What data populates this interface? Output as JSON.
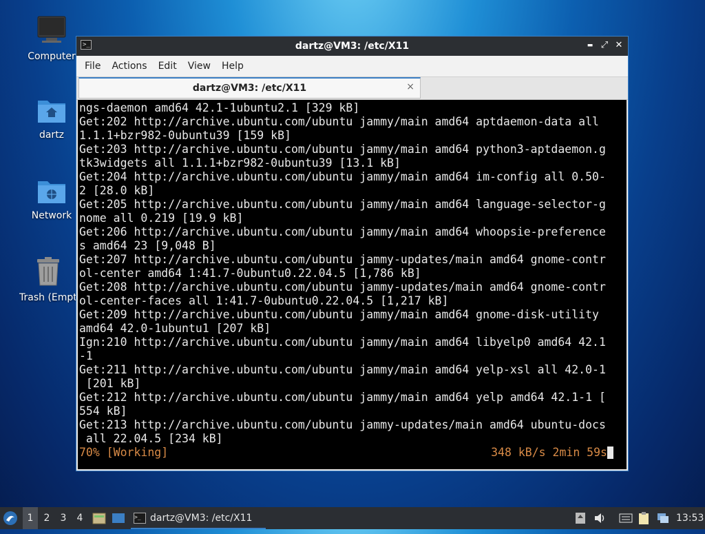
{
  "desktop": {
    "icons": [
      {
        "label": "Computer",
        "icon": "computer-icon"
      },
      {
        "label": "dartz",
        "icon": "home-folder-icon"
      },
      {
        "label": "Network",
        "icon": "network-folder-icon"
      },
      {
        "label": "Trash (Empty)",
        "icon": "trash-icon"
      }
    ]
  },
  "window": {
    "title": "dartz@VM3: /etc/X11",
    "menu": [
      "File",
      "Actions",
      "Edit",
      "View",
      "Help"
    ],
    "tab": {
      "title": "dartz@VM3: /etc/X11",
      "close": "×"
    },
    "controls": {
      "minimize": "▬",
      "maximize": "⤢",
      "close": "✕"
    }
  },
  "terminal": {
    "lines": [
      "ngs-daemon amd64 42.1-1ubuntu2.1 [329 kB]",
      "Get:202 http://archive.ubuntu.com/ubuntu jammy/main amd64 aptdaemon-data all",
      "1.1.1+bzr982-0ubuntu39 [159 kB]",
      "Get:203 http://archive.ubuntu.com/ubuntu jammy/main amd64 python3-aptdaemon.g",
      "tk3widgets all 1.1.1+bzr982-0ubuntu39 [13.1 kB]",
      "Get:204 http://archive.ubuntu.com/ubuntu jammy/main amd64 im-config all 0.50-",
      "2 [28.0 kB]",
      "Get:205 http://archive.ubuntu.com/ubuntu jammy/main amd64 language-selector-g",
      "nome all 0.219 [19.9 kB]",
      "Get:206 http://archive.ubuntu.com/ubuntu jammy/main amd64 whoopsie-preference",
      "s amd64 23 [9,048 B]",
      "Get:207 http://archive.ubuntu.com/ubuntu jammy-updates/main amd64 gnome-contr",
      "ol-center amd64 1:41.7-0ubuntu0.22.04.5 [1,786 kB]",
      "Get:208 http://archive.ubuntu.com/ubuntu jammy-updates/main amd64 gnome-contr",
      "ol-center-faces all 1:41.7-0ubuntu0.22.04.5 [1,217 kB]",
      "Get:209 http://archive.ubuntu.com/ubuntu jammy/main amd64 gnome-disk-utility",
      "amd64 42.0-1ubuntu1 [207 kB]",
      "Ign:210 http://archive.ubuntu.com/ubuntu jammy/main amd64 libyelp0 amd64 42.1",
      "-1",
      "Get:211 http://archive.ubuntu.com/ubuntu jammy/main amd64 yelp-xsl all 42.0-1",
      " [201 kB]",
      "Get:212 http://archive.ubuntu.com/ubuntu jammy/main amd64 yelp amd64 42.1-1 [",
      "554 kB]",
      "Get:213 http://archive.ubuntu.com/ubuntu jammy-updates/main amd64 ubuntu-docs",
      " all 22.04.5 [234 kB]"
    ],
    "status_left": "70% [Working]",
    "status_right": "348 kB/s 2min 59s",
    "status_color": "#d98b47"
  },
  "panel": {
    "workspaces": [
      "1",
      "2",
      "3",
      "4"
    ],
    "active_workspace": "1",
    "task_title": "dartz@VM3: /etc/X11",
    "clock": "13:53",
    "accent": "#3b7fc4"
  }
}
